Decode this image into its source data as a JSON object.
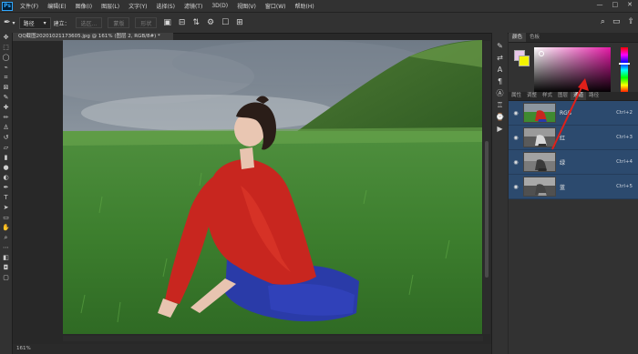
{
  "menu": {
    "logo": "Ps",
    "items": [
      "文件(F)",
      "编辑(E)",
      "图像(I)",
      "图层(L)",
      "文字(Y)",
      "选择(S)",
      "滤镜(T)",
      "3D(D)",
      "视图(V)",
      "窗口(W)",
      "帮助(H)"
    ],
    "window_controls": [
      "—",
      "□",
      "✕"
    ]
  },
  "options": {
    "mode_select": "路径",
    "build_label": "建立：",
    "selection_btn": "选区...",
    "mask_btn": "蒙版",
    "shape_btn": "形状"
  },
  "document": {
    "tab_title": "QQ截图20201021173605.jpg @ 161% (图层 2, RGB/8#) *",
    "status": "161%"
  },
  "panels": {
    "top_tabs": [
      "颜色",
      "色板"
    ],
    "lower_tabs": [
      "属性",
      "调整",
      "样式",
      "图层",
      "通道",
      "路径"
    ],
    "active_lower_tab": "通道",
    "colors": {
      "foreground": "#e8c8e8",
      "background": "#f2f200",
      "selection": "#2c4a6e"
    }
  },
  "channels": [
    {
      "name": "RGB",
      "shortcut": "Ctrl+2"
    },
    {
      "name": "红",
      "shortcut": "Ctrl+3"
    },
    {
      "name": "绿",
      "shortcut": "Ctrl+4"
    },
    {
      "name": "蓝",
      "shortcut": "Ctrl+5"
    }
  ]
}
